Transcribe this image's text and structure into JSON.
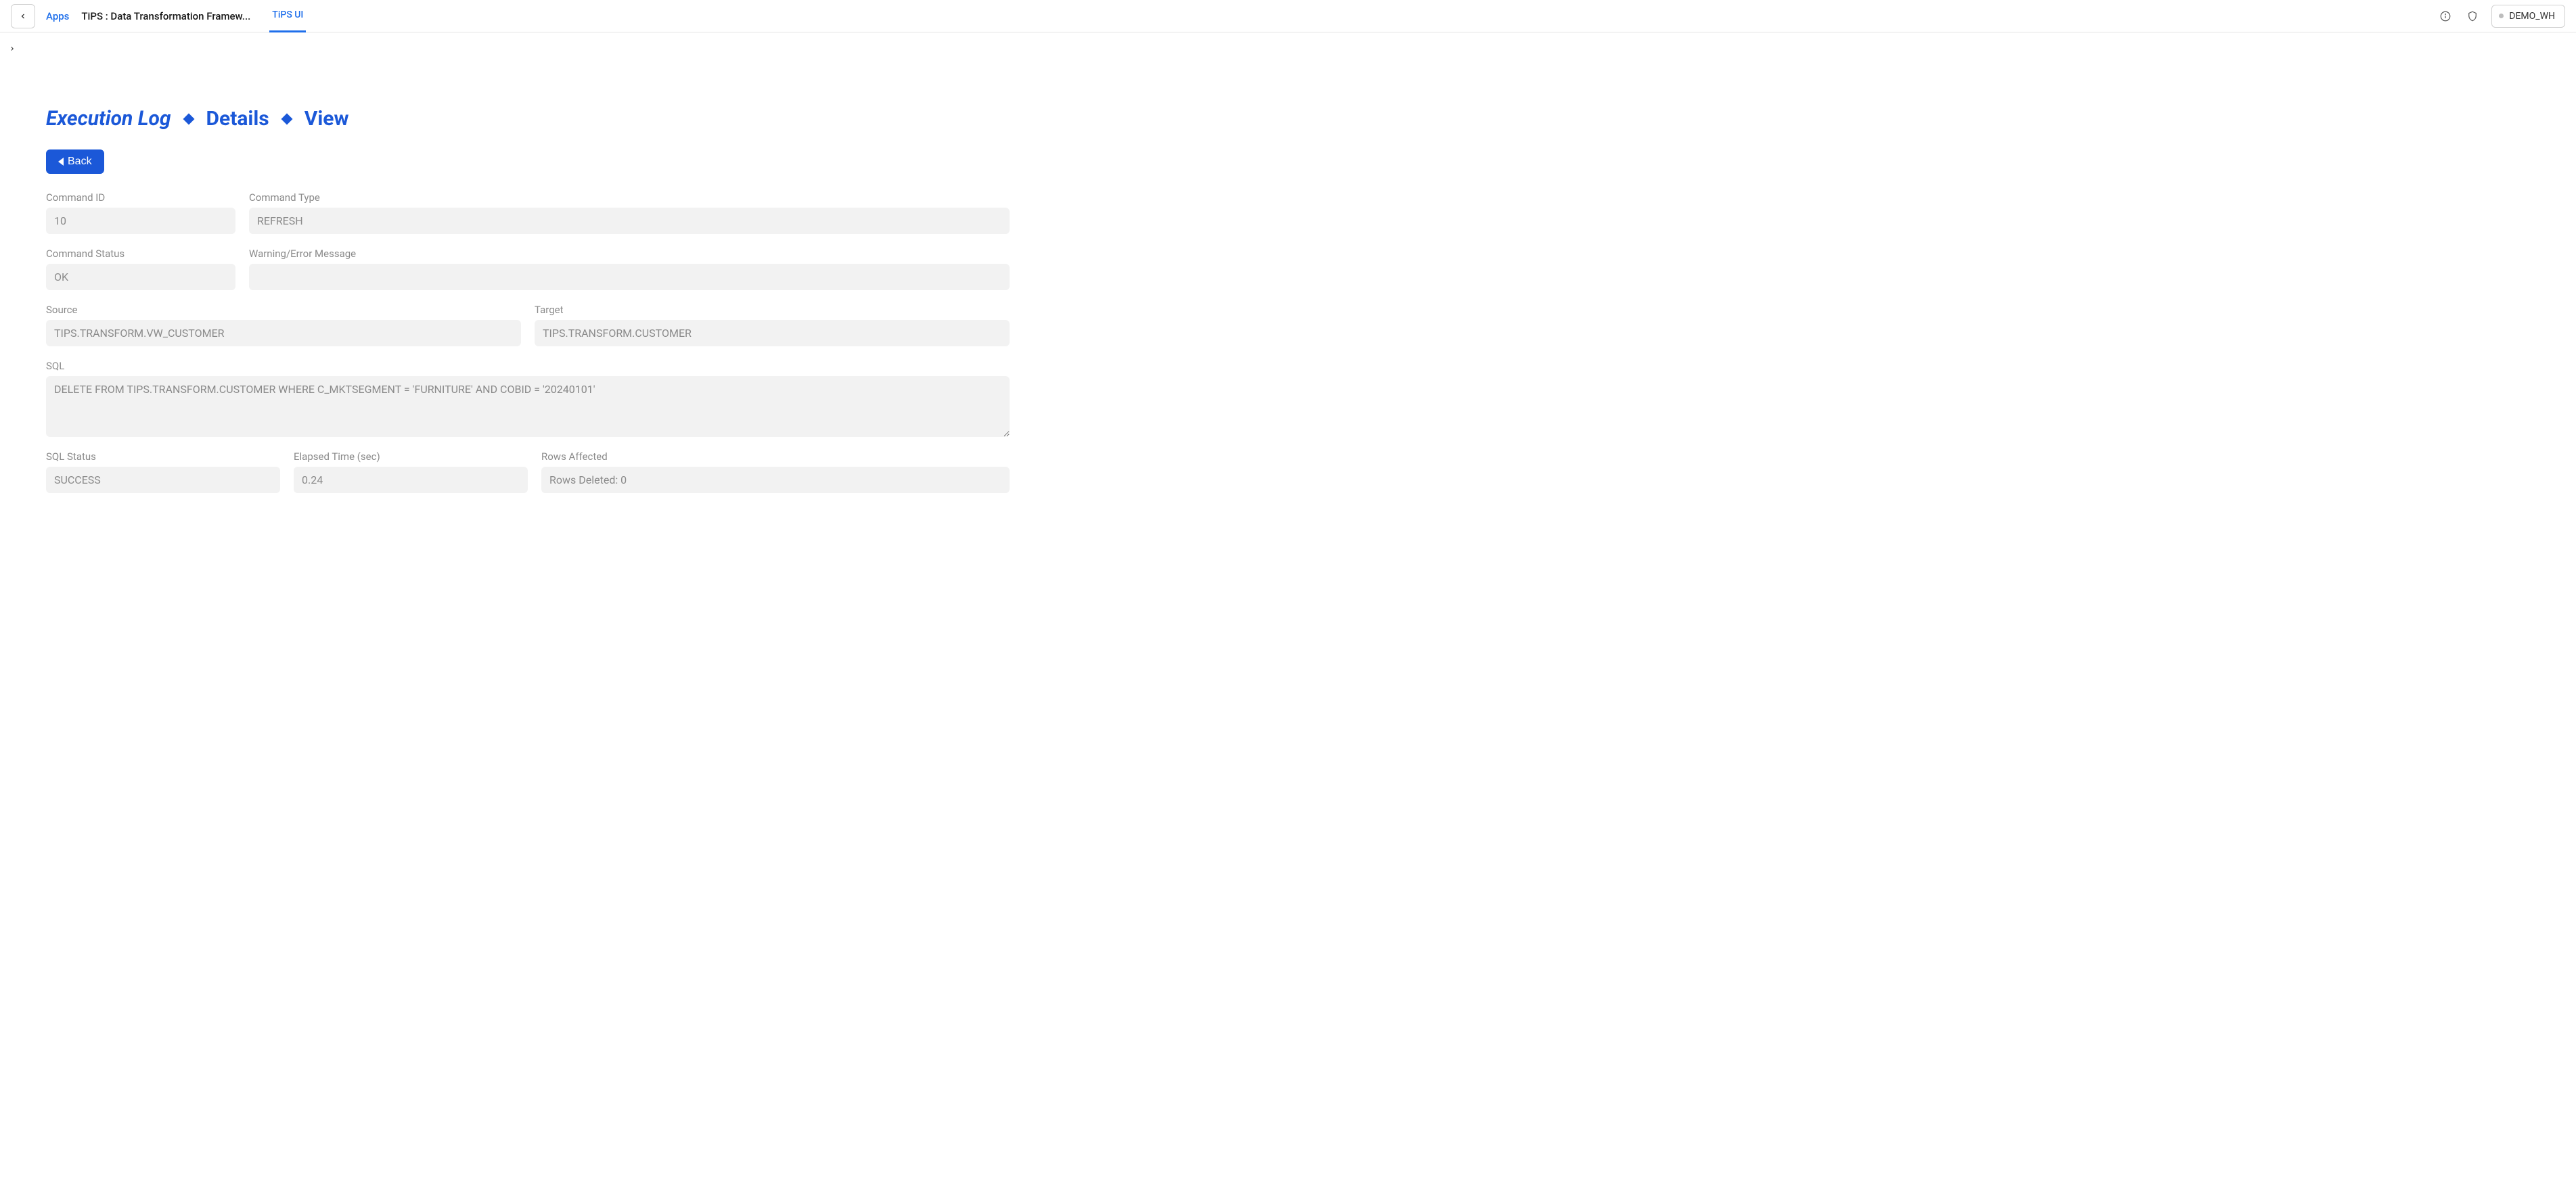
{
  "topbar": {
    "apps_label": "Apps",
    "app_title": "TiPS : Data Transformation Framew...",
    "tab_label": "TiPS UI",
    "warehouse": "DEMO_WH"
  },
  "title": {
    "seg1": "Execution Log",
    "seg2": "Details",
    "seg3": "View"
  },
  "back_button": "Back",
  "fields": {
    "command_id": {
      "label": "Command ID",
      "value": "10"
    },
    "command_type": {
      "label": "Command Type",
      "value": "REFRESH"
    },
    "command_status": {
      "label": "Command Status",
      "value": "OK"
    },
    "warning_error": {
      "label": "Warning/Error Message",
      "value": ""
    },
    "source": {
      "label": "Source",
      "value": "TIPS.TRANSFORM.VW_CUSTOMER"
    },
    "target": {
      "label": "Target",
      "value": "TIPS.TRANSFORM.CUSTOMER"
    },
    "sql": {
      "label": "SQL",
      "value": "DELETE FROM TIPS.TRANSFORM.CUSTOMER WHERE C_MKTSEGMENT = 'FURNITURE' AND COBID = '20240101'"
    },
    "sql_status": {
      "label": "SQL Status",
      "value": "SUCCESS"
    },
    "elapsed_time": {
      "label": "Elapsed Time (sec)",
      "value": "0.24"
    },
    "rows_affected": {
      "label": "Rows Affected",
      "value": "Rows Deleted: 0"
    }
  }
}
